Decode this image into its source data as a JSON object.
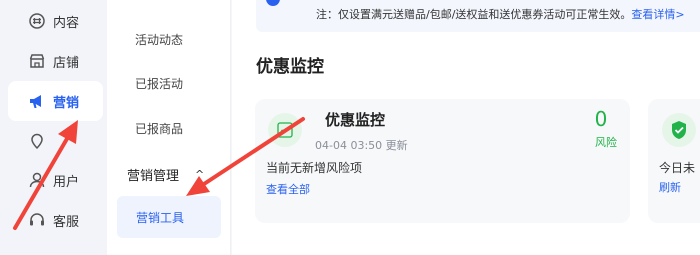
{
  "sidebar_primary": {
    "items": [
      {
        "label": "内容",
        "icon": "content-icon",
        "active": false
      },
      {
        "label": "店铺",
        "icon": "store-icon",
        "active": false
      },
      {
        "label": "营销",
        "icon": "megaphone-icon",
        "active": true
      },
      {
        "label": "",
        "icon": "location-pin-icon",
        "active": false
      },
      {
        "label": "用户",
        "icon": "user-icon",
        "active": false
      },
      {
        "label": "客服",
        "icon": "headset-icon",
        "active": false
      }
    ]
  },
  "sidebar_secondary": {
    "items": [
      "活动动态",
      "已报活动",
      "已报商品"
    ],
    "group_label": "营销管理",
    "group_chevron": "^",
    "active_item": "营销工具"
  },
  "notice": {
    "text": "注：仅设置满元送赠品/包邮/送权益和送优惠券活动可正常生效。",
    "link": "查看详情>"
  },
  "main": {
    "section_title": "优惠监控"
  },
  "card": {
    "title": "优惠监控",
    "timestamp": "04-04 03:50 更新",
    "count": "0",
    "count_label": "风险",
    "description": "当前无新增风险项",
    "link": "查看全部"
  },
  "card2": {
    "description": "今日未",
    "link": "刷新"
  },
  "colors": {
    "accent": "#2a62f0",
    "success": "#21b34a",
    "annotation_arrow": "#f0433a"
  }
}
